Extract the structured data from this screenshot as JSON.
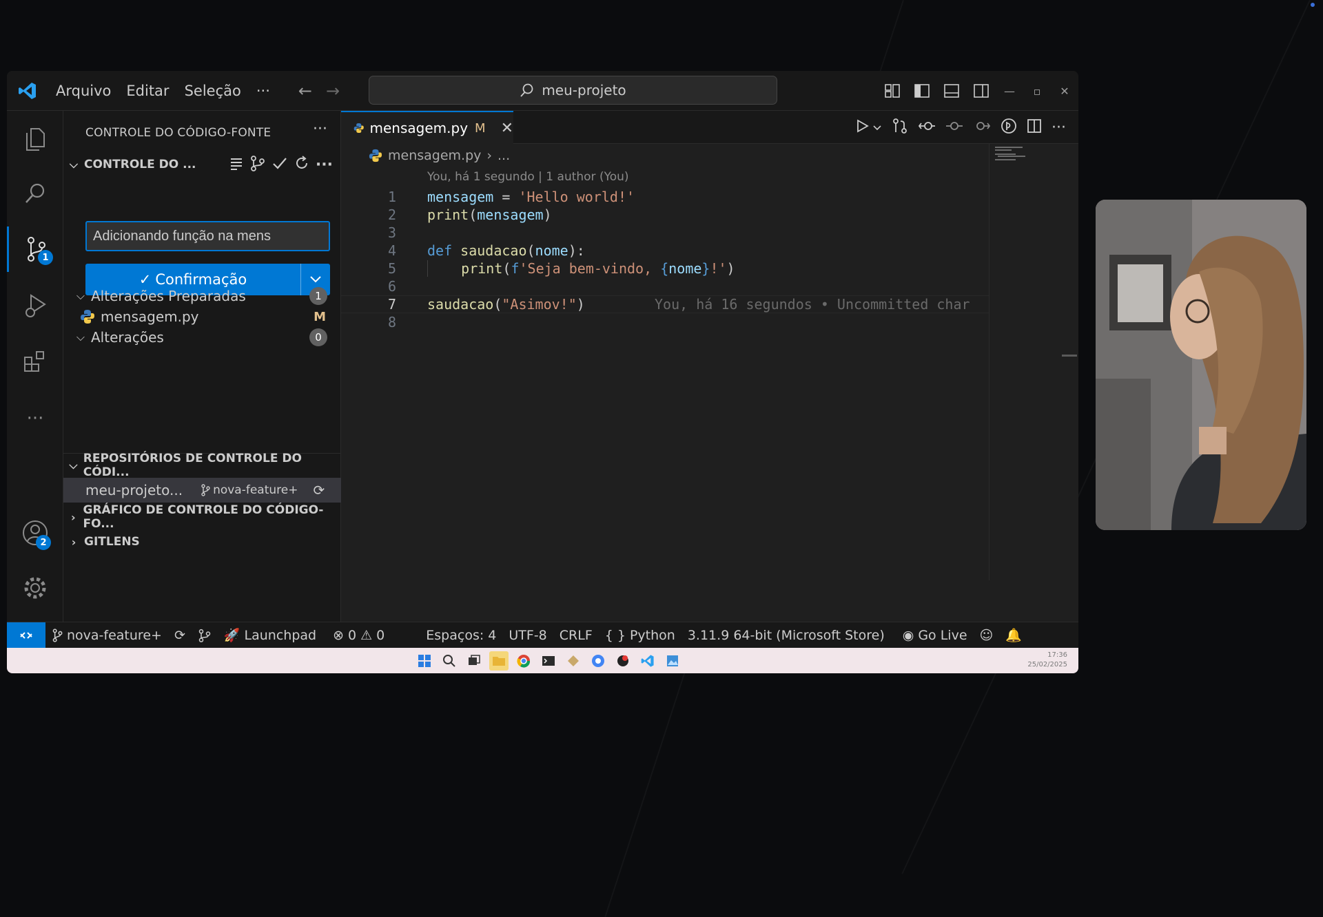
{
  "titlebar": {
    "menu": [
      "Arquivo",
      "Editar",
      "Seleção",
      "···"
    ],
    "command_center": "meu-projeto"
  },
  "activity_bar": {
    "scm_badge": "1",
    "accounts_badge": "2",
    "more": "···"
  },
  "sidebar": {
    "title": "CONTROLE DO CÓDIGO-FONTE",
    "more": "···",
    "section_title": "CONTROLE DO ...",
    "commit_message": "Adicionando função na mens",
    "commit_button": "Confirmação",
    "staged": {
      "label": "Alterações Preparadas",
      "count": "1"
    },
    "staged_file": {
      "name": "mensagem.py",
      "status": "M"
    },
    "changes": {
      "label": "Alterações",
      "count": "0"
    },
    "repos_header": "REPOSITÓRIOS DE CONTROLE DO CÓDI...",
    "repo": {
      "name": "meu-projeto...",
      "branch": "nova-feature+"
    },
    "graph_header": "GRÁFICO DE CONTROLE DO CÓDIGO-FO...",
    "gitlens_header": "GITLENS"
  },
  "editor": {
    "tab": {
      "name": "mensagem.py",
      "status": "M"
    },
    "breadcrumb": {
      "file": "mensagem.py",
      "rest": "..."
    },
    "blame_header": "You, há 1 segundo | 1 author (You)",
    "line_numbers": [
      "1",
      "2",
      "3",
      "4",
      "5",
      "6",
      "7",
      "8"
    ],
    "current_line": 7,
    "code": {
      "l1_var": "mensagem",
      "l1_op": " = ",
      "l1_str": "'Hello world!'",
      "l2_fn": "print",
      "l2_open": "(",
      "l2_arg": "mensagem",
      "l2_close": ")",
      "l4_kw": "def",
      "l4_fn": " saudacao",
      "l4_open": "(",
      "l4_arg": "nome",
      "l4_close": "):",
      "l5_indent": "    ",
      "l5_fn": "print",
      "l5_open": "(",
      "l5_kw": "f",
      "l5_str1": "'Seja bem-vindo, ",
      "l5_b1": "{",
      "l5_var": "nome",
      "l5_b2": "}",
      "l5_str2": "!'",
      "l5_close": ")",
      "l7_fn": "saudacao",
      "l7_open": "(",
      "l7_str": "\"Asimov!\"",
      "l7_close": ")",
      "l7_ghost": "You, há 16 segundos • Uncommitted char"
    }
  },
  "statusbar": {
    "branch": "nova-feature+",
    "launchpad": "Launchpad",
    "errors": "0",
    "warnings": "0",
    "spaces": "Espaços: 4",
    "encoding": "UTF-8",
    "eol": "CRLF",
    "language": "Python",
    "interpreter": "3.11.9 64-bit (Microsoft Store)",
    "golive": "Go Live"
  },
  "taskbar": {
    "time": "17:36",
    "date": "25/02/2025"
  },
  "colors": {
    "accent": "#0078d4",
    "modified": "#e2c08d"
  }
}
